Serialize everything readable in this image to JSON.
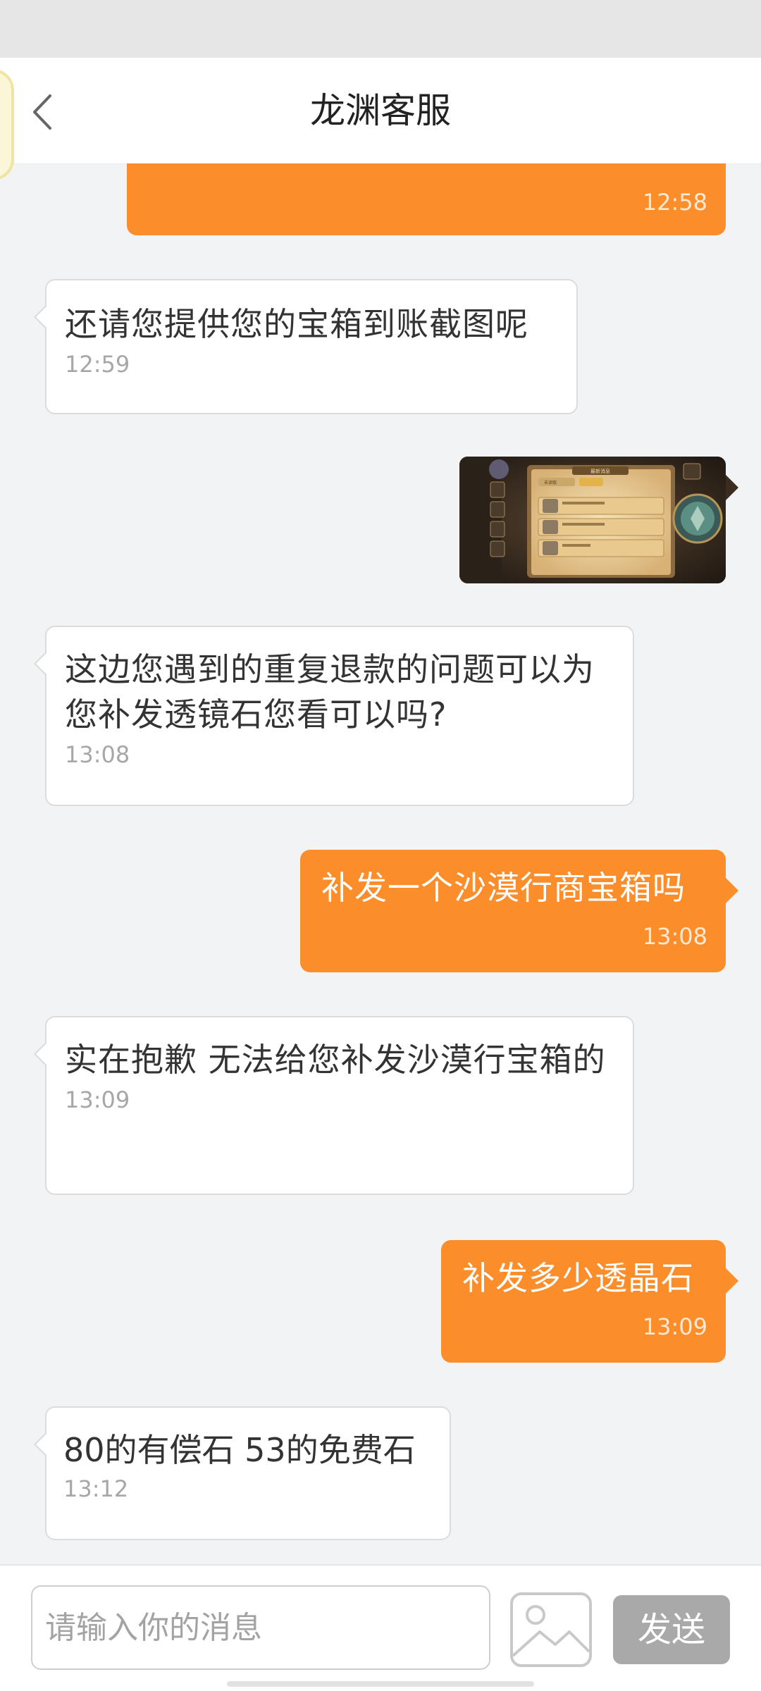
{
  "header": {
    "title": "龙渊客服",
    "back_icon": "chevron-left-icon"
  },
  "messages": [
    {
      "side": "out",
      "text": "",
      "time": "12:58"
    },
    {
      "side": "in",
      "text": "还请您提供您的宝箱到账截图呢",
      "time": "12:59"
    },
    {
      "side": "out",
      "type": "image",
      "image_texts": [
        "最新消息",
        "未读取"
      ]
    },
    {
      "side": "in",
      "text": "这边您遇到的重复退款的问题可以为您补发透镜石您看可以吗?",
      "time": "13:08"
    },
    {
      "side": "out",
      "text": "补发一个沙漠行商宝箱吗",
      "time": "13:08"
    },
    {
      "side": "in",
      "text": "实在抱歉 无法给您补发沙漠行宝箱的",
      "time": "13:09"
    },
    {
      "side": "out",
      "text": "补发多少透晶石",
      "time": "13:09"
    },
    {
      "side": "in",
      "text": "80的有偿石 53的免费石",
      "time": "13:12"
    }
  ],
  "composer": {
    "placeholder": "请输入你的消息",
    "image_icon": "image-icon",
    "send_label": "发送"
  },
  "colors": {
    "outgoing_bubble": "#fb8d2a",
    "incoming_bubble": "#ffffff",
    "send_button": "#a9a9a9",
    "background": "#f2f3f5"
  }
}
